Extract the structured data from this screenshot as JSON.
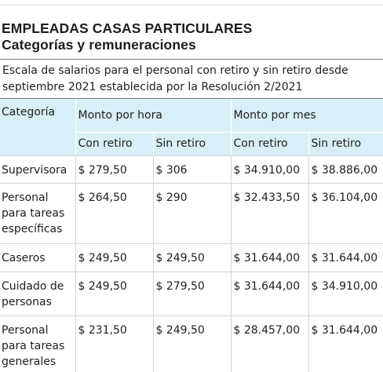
{
  "heading": {
    "title_line1": "EMPLEADAS CASAS PARTICULARES",
    "title_line2": "Categorías y remuneraciones"
  },
  "description": "Escala de salarios para el personal con retiro y sin retiro desde septiembre 2021 establecida por la Resolución 2/2021",
  "table": {
    "category_header": "Categoría",
    "group_headers": [
      "Monto por hora",
      "Monto por mes"
    ],
    "sub_headers": [
      "Con retiro",
      "Sin retiro",
      "Con retiro",
      "Sin retiro"
    ],
    "rows": [
      {
        "category": "Supervisora",
        "values": [
          "$ 279,50",
          "$ 306",
          "$ 34.910,00",
          "$ 38.886,00"
        ]
      },
      {
        "category": "Personal para tareas específicas",
        "values": [
          "$ 264,50",
          "$ 290",
          "$ 32.433,50",
          "$ 36.104,00"
        ]
      },
      {
        "category": "Caseros",
        "values": [
          "$ 249,50",
          "$ 249,50",
          "$ 31.644,00",
          "$ 31.644,00"
        ]
      },
      {
        "category": "Cuidado de personas",
        "values": [
          "$ 249,50",
          "$ 279,50",
          "$ 31.644,00",
          "$ 34.910,00"
        ]
      },
      {
        "category": "Personal para tareas generales",
        "values": [
          "$ 231,50",
          "$ 249,50",
          "$ 28.457,00",
          "$ 31.644,00"
        ]
      }
    ]
  }
}
